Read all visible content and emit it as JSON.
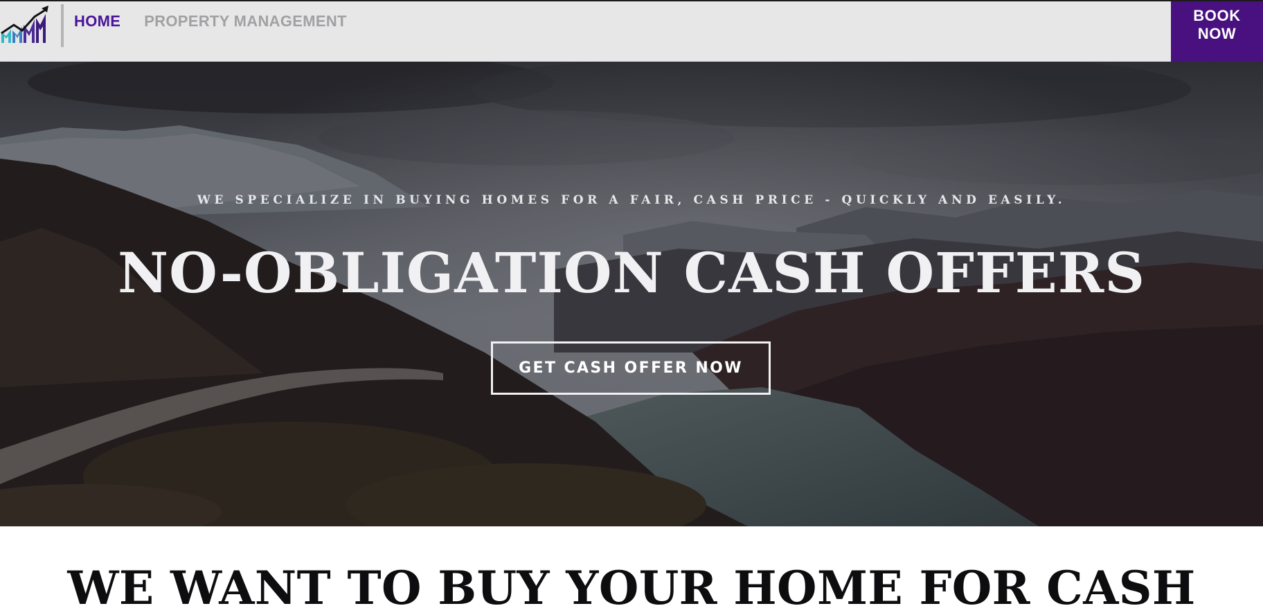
{
  "header": {
    "nav": [
      {
        "label": "HOME",
        "active": true
      },
      {
        "label": "PROPERTY MANAGEMENT",
        "active": false
      }
    ],
    "book_button": {
      "line1": "BOOK",
      "line2": "NOW"
    }
  },
  "hero": {
    "tagline": "WE SPECIALIZE IN BUYING HOMES FOR A FAIR, CASH PRICE - QUICKLY AND EASILY.",
    "title": "NO-OBLIGATION CASH OFFERS",
    "cta": "GET CASH OFFER NOW"
  },
  "section": {
    "title": "WE WANT TO BUY YOUR HOME FOR CASH"
  },
  "colors": {
    "brand_purple": "#48117f",
    "active_nav": "#4a1497",
    "inactive_nav": "#a1a1a3",
    "header_bg": "#e7e7e8",
    "logo_teal": "#34b7c8"
  },
  "icons": {
    "logo": "growth-chart-logo-icon"
  }
}
